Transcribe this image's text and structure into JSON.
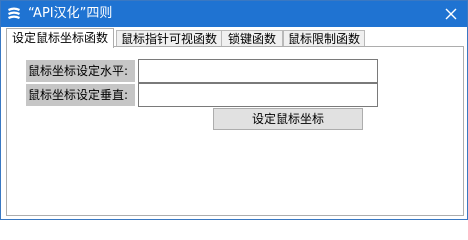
{
  "window": {
    "title": "“API汉化”四则",
    "app_icon": "app-logo-icon",
    "close_icon": "close-icon",
    "title_bar_color": "#1f73d2"
  },
  "tabs": [
    {
      "label": "设定鼠标坐标函数",
      "active": true
    },
    {
      "label": "鼠标指针可视函数",
      "active": false
    },
    {
      "label": "锁键函数",
      "active": false
    },
    {
      "label": "鼠标限制函数",
      "active": false
    }
  ],
  "form": {
    "horizontal_label": "鼠标坐标设定水平:",
    "horizontal_value": "",
    "vertical_label": "鼠标坐标设定垂直:",
    "vertical_value": "",
    "submit_label": "设定鼠标坐标"
  }
}
